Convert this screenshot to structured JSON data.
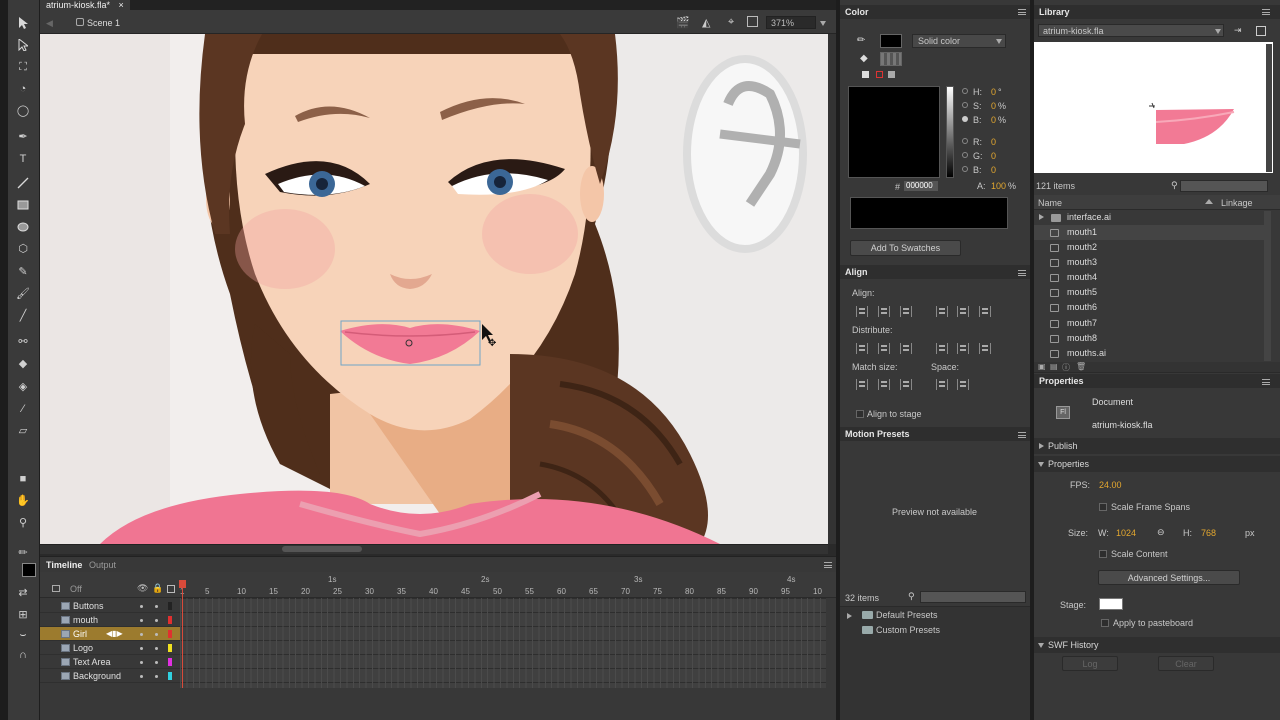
{
  "document": {
    "tab_title": "atrium-kiosk.fla*",
    "scene": "Scene 1",
    "zoom": "371%"
  },
  "timeline": {
    "tab_timeline": "Timeline",
    "tab_output": "Output",
    "onion": "Off",
    "seconds": [
      "1s",
      "2s",
      "3s",
      "4s"
    ],
    "frame_numbers": [
      "1",
      "5",
      "10",
      "15",
      "20",
      "25",
      "30",
      "35",
      "40",
      "45",
      "50",
      "55",
      "60",
      "65",
      "70",
      "75",
      "80",
      "85",
      "90",
      "95",
      "10"
    ],
    "layers": [
      {
        "name": "Buttons",
        "color": "#222222"
      },
      {
        "name": "mouth",
        "color": "#e03030"
      },
      {
        "name": "Girl",
        "color": "#e03030",
        "active": true
      },
      {
        "name": "Logo",
        "color": "#f0e020"
      },
      {
        "name": "Text Area",
        "color": "#e030e0"
      },
      {
        "name": "Background",
        "color": "#30d0e0"
      }
    ]
  },
  "color_panel": {
    "title": "Color",
    "fill_type": "Solid color",
    "hsb": {
      "h_label": "H:",
      "h": "0",
      "h_unit": "°",
      "s_label": "S:",
      "s": "0",
      "s_unit": "%",
      "b_label": "B:",
      "b": "0",
      "b_unit": "%"
    },
    "rgb": {
      "r_label": "R:",
      "r": "0",
      "g_label": "G:",
      "g": "0",
      "b_label": "B:",
      "b": "0"
    },
    "hex_label": "#",
    "hex": "000000",
    "alpha_label": "A:",
    "alpha": "100",
    "alpha_unit": "%",
    "add_swatches": "Add To Swatches"
  },
  "align_panel": {
    "title": "Align",
    "align_label": "Align:",
    "distribute_label": "Distribute:",
    "match_label": "Match size:",
    "space_label": "Space:",
    "align_to_stage": "Align to stage"
  },
  "motion_presets": {
    "title": "Motion Presets",
    "preview": "Preview not available",
    "count": "32 items",
    "folders": [
      "Default Presets",
      "Custom Presets"
    ]
  },
  "library": {
    "title": "Library",
    "selected_doc": "atrium-kiosk.fla",
    "count": "121 items",
    "col_name": "Name",
    "col_linkage": "Linkage",
    "items": [
      {
        "name": "interface.ai",
        "kind": "folder"
      },
      {
        "name": "mouth1",
        "kind": "graphic",
        "selected": true
      },
      {
        "name": "mouth2",
        "kind": "graphic"
      },
      {
        "name": "mouth3",
        "kind": "graphic"
      },
      {
        "name": "mouth4",
        "kind": "graphic"
      },
      {
        "name": "mouth5",
        "kind": "graphic"
      },
      {
        "name": "mouth6",
        "kind": "graphic"
      },
      {
        "name": "mouth7",
        "kind": "graphic"
      },
      {
        "name": "mouth8",
        "kind": "graphic"
      },
      {
        "name": "mouths.ai",
        "kind": "graphic"
      }
    ]
  },
  "properties": {
    "title": "Properties",
    "doc_type": "Document",
    "doc_name": "atrium-kiosk.fla",
    "publish": "Publish",
    "props_section": "Properties",
    "fps_label": "FPS:",
    "fps": "24.00",
    "scale_frame_spans": "Scale Frame Spans",
    "size_label": "Size:",
    "w_label": "W:",
    "w": "1024",
    "h_label": "H:",
    "h": "768",
    "unit": "px",
    "scale_content": "Scale Content",
    "advanced": "Advanced Settings...",
    "stage_label": "Stage:",
    "apply_pasteboard": "Apply to pasteboard",
    "swf_history": "SWF History",
    "log": "Log",
    "clear": "Clear"
  },
  "colors": {
    "accent_value": "#e3a72f",
    "lip": "#f27a95",
    "shirt": "#f07592",
    "hair": "#5b3622",
    "skin": "#f6cfb4"
  }
}
